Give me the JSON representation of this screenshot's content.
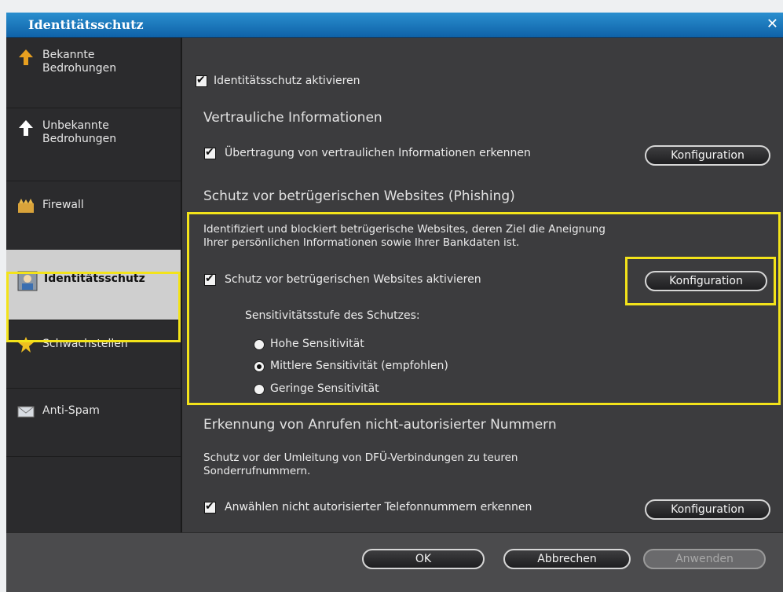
{
  "window": {
    "title": "Identitätsschutz",
    "close": "✕"
  },
  "sidebar": {
    "items": [
      {
        "label": "Bekannte\nBedrohungen",
        "icon": "up-arrow-icon"
      },
      {
        "label": "Unbekannte\nBedrohungen",
        "icon": "up-arrow-icon"
      },
      {
        "label": "Firewall",
        "icon": "firewall-icon"
      },
      {
        "label": "Identitätsschutz",
        "icon": "identity-icon"
      },
      {
        "label": "Schwachstellen",
        "icon": "star-icon"
      },
      {
        "label": "Anti-Spam",
        "icon": "envelope-icon"
      }
    ]
  },
  "main": {
    "enable_label": "Identitätsschutz aktivieren",
    "confidential": {
      "title": "Vertrauliche Informationen",
      "checkbox_label": "Übertragung von vertraulichen Informationen erkennen",
      "button": "Konfiguration"
    },
    "phishing": {
      "title": "Schutz vor betrügerischen Websites (Phishing)",
      "description": "Identifiziert und blockiert betrügerische Websites, deren Ziel die Aneignung\nIhrer persönlichen Informationen sowie Ihrer Bankdaten ist.",
      "checkbox_label": "Schutz vor betrügerischen Websites aktivieren",
      "button": "Konfiguration",
      "sensitivity_label": "Sensitivitätsstufe des Schutzes:",
      "options": [
        "Hohe Sensitivität",
        "Mittlere Sensitivität (empfohlen)",
        "Geringe Sensitivität"
      ],
      "selected": "Mittlere Sensitivität (empfohlen)"
    },
    "dialer": {
      "title": "Erkennung von Anrufen nicht-autorisierter Nummern",
      "description": "Schutz vor der Umleitung von DFÜ-Verbindungen zu teuren\nSonderrufnummern.",
      "checkbox_label": "Anwählen nicht autorisierter Telefonnummern erkennen",
      "button": "Konfiguration"
    }
  },
  "footer": {
    "ok": "OK",
    "cancel": "Abbrechen",
    "apply": "Anwenden"
  },
  "colors": {
    "highlight": "#f3e31a",
    "titlebar": "#1a78c2",
    "panel": "#3c3c3e"
  }
}
